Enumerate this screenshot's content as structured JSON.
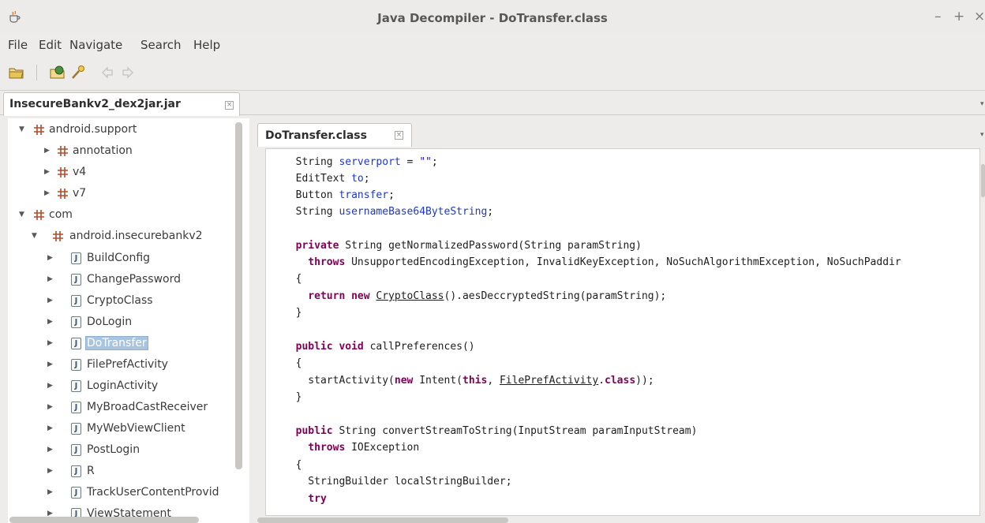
{
  "window": {
    "title": "Java Decompiler - DoTransfer.class",
    "controls": [
      "–",
      "+",
      "×"
    ]
  },
  "menu": [
    "File",
    "Edit",
    "Navigate",
    "Search",
    "Help"
  ],
  "toolbar": {
    "icons": [
      "open-file-icon",
      "open-type-icon",
      "search-icon",
      "back-arrow-icon",
      "forward-arrow-icon"
    ]
  },
  "file_tab": {
    "label": "InsecureBankv2_dex2jar.jar",
    "close": "×"
  },
  "code_tab": {
    "label": "DoTransfer.class",
    "close": "×"
  },
  "tree": [
    {
      "label": "android.support",
      "type": "package",
      "level": 0,
      "expanded": true
    },
    {
      "label": "annotation",
      "type": "package",
      "level": 1,
      "expanded": false
    },
    {
      "label": "v4",
      "type": "package",
      "level": 1,
      "expanded": false
    },
    {
      "label": "v7",
      "type": "package",
      "level": 1,
      "expanded": false
    },
    {
      "label": "com",
      "type": "package",
      "level": 0,
      "expanded": true
    },
    {
      "label": "android.insecurebankv2",
      "type": "package",
      "level": 1,
      "expanded": true
    },
    {
      "label": "BuildConfig",
      "type": "class",
      "level": 2
    },
    {
      "label": "ChangePassword",
      "type": "class",
      "level": 2
    },
    {
      "label": "CryptoClass",
      "type": "class",
      "level": 2
    },
    {
      "label": "DoLogin",
      "type": "class",
      "level": 2
    },
    {
      "label": "DoTransfer",
      "type": "class",
      "level": 2,
      "selected": true
    },
    {
      "label": "FilePrefActivity",
      "type": "class",
      "level": 2
    },
    {
      "label": "LoginActivity",
      "type": "class",
      "level": 2
    },
    {
      "label": "MyBroadCastReceiver",
      "type": "class",
      "level": 2
    },
    {
      "label": "MyWebViewClient",
      "type": "class",
      "level": 2
    },
    {
      "label": "PostLogin",
      "type": "class",
      "level": 2
    },
    {
      "label": "R",
      "type": "class",
      "level": 2
    },
    {
      "label": "TrackUserContentProvid",
      "type": "class",
      "level": 2
    },
    {
      "label": "ViewStatement",
      "type": "class",
      "level": 2
    }
  ],
  "class_icon_letter": "J",
  "code": {
    "l01": "  String serverport = \"\";",
    "l02": "  EditText to;",
    "l03": "  Button transfer;",
    "l04": "  String usernameBase64ByteString;",
    "l06a": "  private",
    "l06b": " String getNormalizedPassword(String paramString)",
    "l07a": "    throws",
    "l07b": " UnsupportedEncodingException, InvalidKeyException, NoSuchAlgorithmException, NoSuchPaddir",
    "l08": "  {",
    "l09a": "    return new",
    "l09b": " ",
    "l09c": "CryptoClass",
    "l09d": "().aesDeccryptedString(paramString);",
    "l10": "  }",
    "l12a": "  public void",
    "l12b": " callPreferences()",
    "l13": "  {",
    "l14a": "    startActivity(",
    "l14b": "new",
    "l14c": " Intent(",
    "l14d": "this",
    "l14e": ", ",
    "l14f": "FilePrefActivity",
    "l14g": ".",
    "l14h": "class",
    "l14i": "));",
    "l15": "  }",
    "l17a": "  public",
    "l17b": " String convertStreamToString(InputStream paramInputStream)",
    "l18a": "    throws",
    "l18b": " IOException",
    "l19": "  {",
    "l20": "    StringBuilder localStringBuilder;",
    "l21": "    try"
  }
}
